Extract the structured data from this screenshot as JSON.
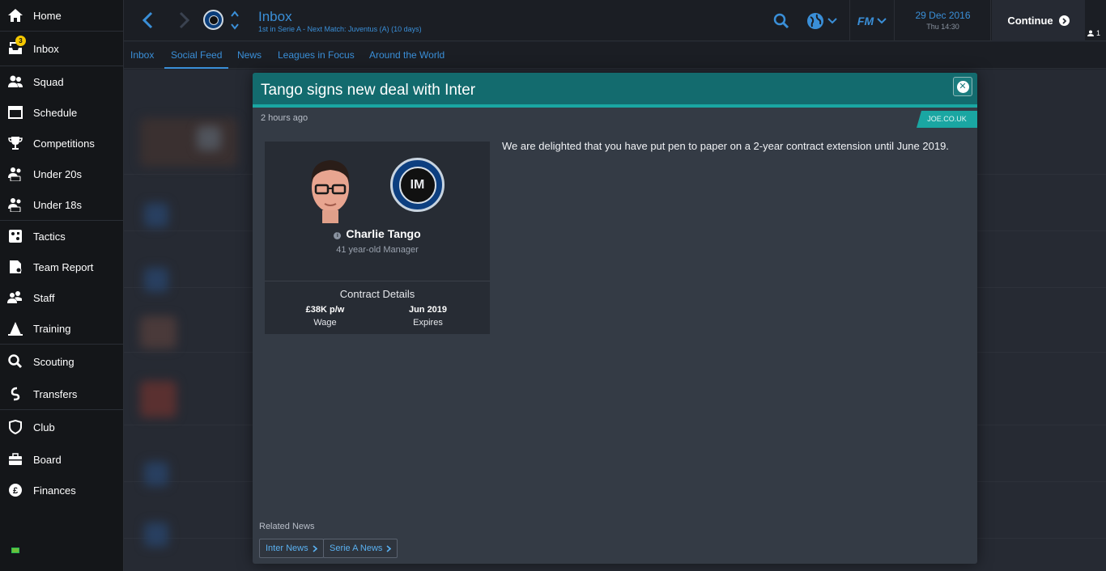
{
  "sidebar": {
    "items": [
      {
        "label": "Home",
        "icon": "home-icon"
      },
      {
        "label": "Inbox",
        "icon": "inbox-icon",
        "badge": "3"
      },
      {
        "label": "Squad",
        "icon": "squad-icon"
      },
      {
        "label": "Schedule",
        "icon": "calendar-icon"
      },
      {
        "label": "Competitions",
        "icon": "trophy-icon"
      },
      {
        "label": "Under 20s",
        "icon": "u20-icon"
      },
      {
        "label": "Under 18s",
        "icon": "u18-icon"
      },
      {
        "label": "Tactics",
        "icon": "tactics-icon"
      },
      {
        "label": "Team Report",
        "icon": "report-icon"
      },
      {
        "label": "Staff",
        "icon": "staff-icon"
      },
      {
        "label": "Training",
        "icon": "training-icon"
      },
      {
        "label": "Scouting",
        "icon": "search-icon"
      },
      {
        "label": "Transfers",
        "icon": "transfers-icon"
      },
      {
        "label": "Club",
        "icon": "shield-icon"
      },
      {
        "label": "Board",
        "icon": "briefcase-icon"
      },
      {
        "label": "Finances",
        "icon": "pound-icon"
      }
    ]
  },
  "header": {
    "title": "Inbox",
    "subtitle": "1st in Serie A - Next Match: Juventus (A) (10 days)",
    "date": "29 Dec 2016",
    "time": "Thu 14:30",
    "continue_label": "Continue",
    "user_count": "1"
  },
  "tabs": [
    {
      "label": "Inbox",
      "active": false
    },
    {
      "label": "Social Feed",
      "active": true
    },
    {
      "label": "News",
      "active": false
    },
    {
      "label": "Leagues in Focus",
      "active": false
    },
    {
      "label": "Around the World",
      "active": false
    }
  ],
  "article": {
    "title": "Tango signs new deal with Inter",
    "timestamp": "2 hours ago",
    "source": "JOE.CO.UK",
    "body": "We are delighted that you have put pen to paper on a 2-year contract extension until June 2019.",
    "person": {
      "name": "Charlie Tango",
      "description": "41 year-old Manager"
    },
    "contract": {
      "title": "Contract Details",
      "wage_value": "£38K p/w",
      "wage_label": "Wage",
      "expires_value": "Jun 2019",
      "expires_label": "Expires"
    },
    "related_label": "Related News",
    "related": [
      "Inter News",
      "Serie A News"
    ]
  },
  "colors": {
    "accent": "#3a8fd8",
    "header_teal": "#136b6e",
    "source_teal": "#1aa6a2",
    "badge_yellow": "#f5c800"
  }
}
